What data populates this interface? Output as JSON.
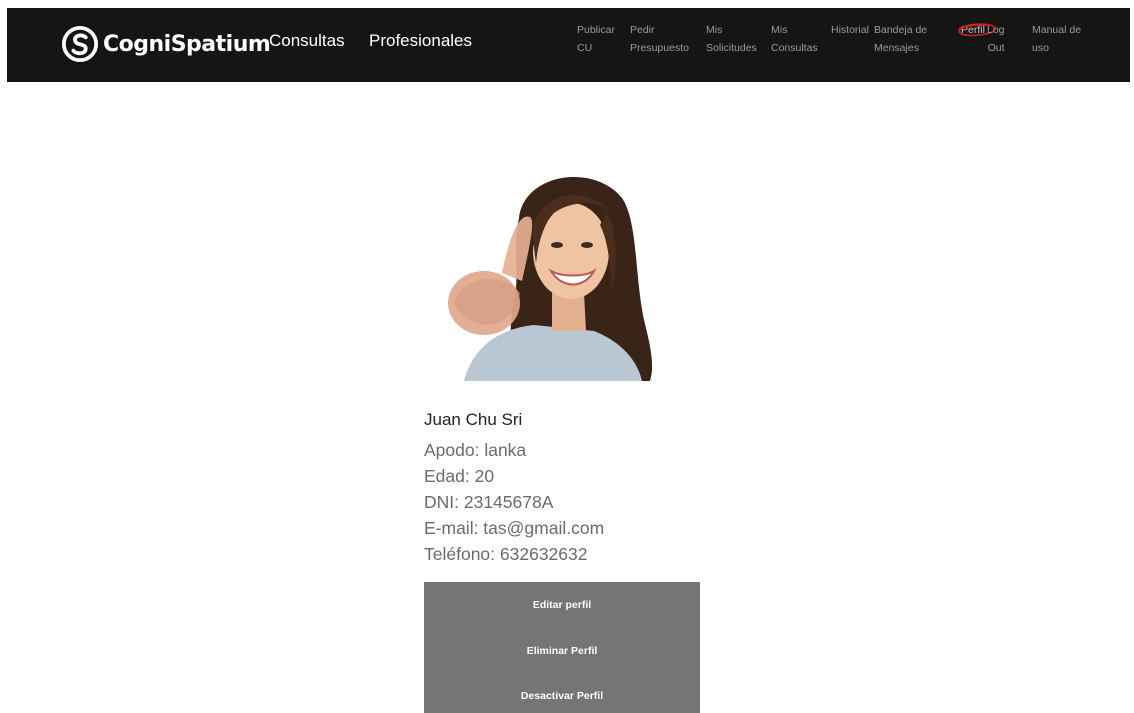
{
  "navbar": {
    "brand": "CogniSpatium",
    "main_links": [
      "Consultas",
      "Profesionales"
    ],
    "sub_links": {
      "publicar_cu": "Publicar\nCU",
      "pedir_presupuesto": "Pedir\nPresupuesto",
      "mis_solicitudes": "Mis\nSolicitudes",
      "mis_consultas": "Mis\nConsultas",
      "historial": "Historial",
      "bandeja_mensajes": "Bandeja de\nMensajes",
      "perfil": "Perfil",
      "log_out": "Log\nOut",
      "manual_uso": "Manual de\nuso"
    },
    "colors": {
      "background": "#151515",
      "annotation_circle": "#d21f1f"
    }
  },
  "profile": {
    "photo_alt": "profile-photo",
    "name": "Juan Chu Sri",
    "apodo": "Apodo: lanka",
    "edad": "Edad: 20",
    "dni": "DNI: 23145678A",
    "email": "E-mail: tas@gmail.com",
    "telefono": "Teléfono: 632632632"
  },
  "actions": {
    "edit": "Editar perfil",
    "delete": "Eliminar Perfil",
    "deactivate": "Desactivar Perfil",
    "panel_color": "#757575"
  }
}
